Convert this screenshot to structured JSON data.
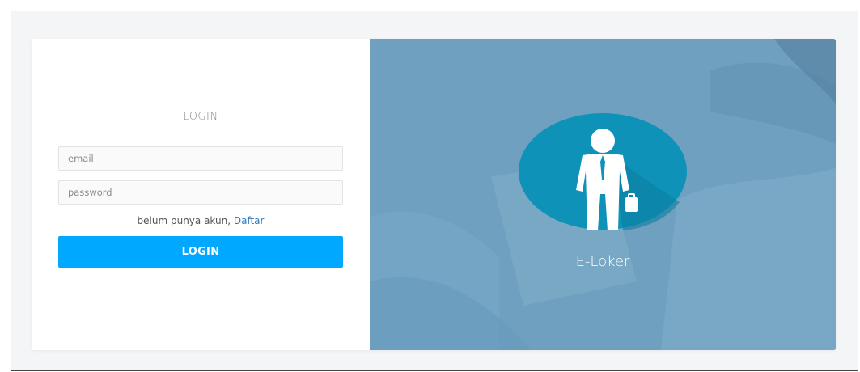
{
  "login_form": {
    "title": "LOGIN",
    "email_placeholder": "email",
    "password_placeholder": "password",
    "register_prompt": "belum punya akun, ",
    "register_link": "Daftar",
    "submit_label": "LOGIN"
  },
  "brand": {
    "name": "E-Loker",
    "logo_icon": "businessman-with-briefcase-icon"
  },
  "colors": {
    "accent": "#00a8ff",
    "panel_bg": "#6e9fbf",
    "logo_circle": "#0e92b8",
    "link": "#2b79c2"
  }
}
